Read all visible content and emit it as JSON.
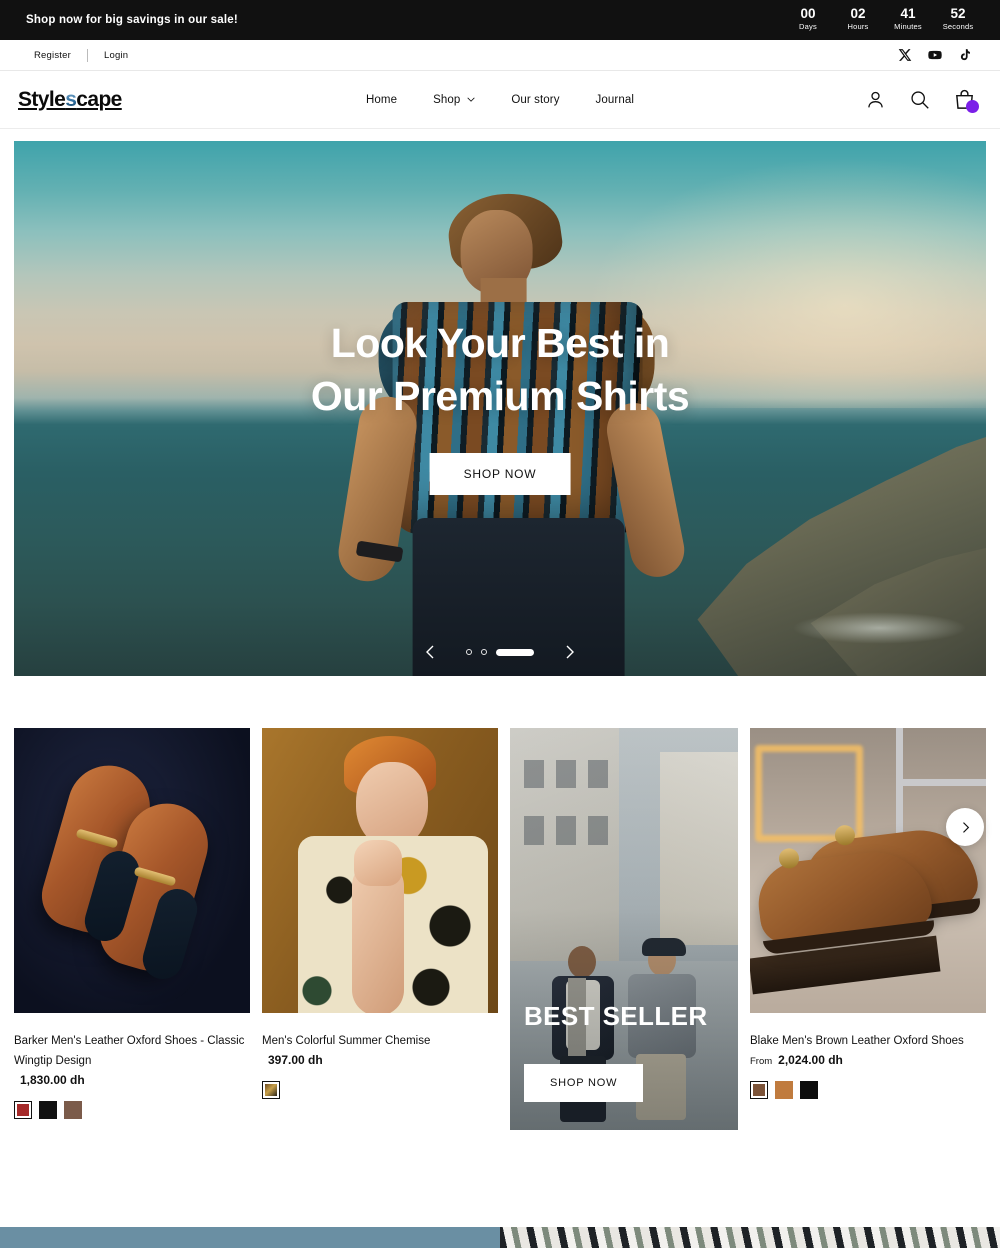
{
  "announcement": {
    "text": "Shop now for big savings in our sale!",
    "countdown": [
      {
        "value": "00",
        "label": "Days"
      },
      {
        "value": "02",
        "label": "Hours"
      },
      {
        "value": "41",
        "label": "Minutes"
      },
      {
        "value": "52",
        "label": "Seconds"
      }
    ]
  },
  "utility": {
    "register": "Register",
    "login": "Login",
    "socials": [
      {
        "name": "x-twitter-icon"
      },
      {
        "name": "youtube-icon"
      },
      {
        "name": "tiktok-icon"
      }
    ]
  },
  "header": {
    "logo_part1": "Style",
    "logo_accent": "s",
    "logo_part2": "cape",
    "nav": [
      {
        "label": "Home",
        "has_chevron": false
      },
      {
        "label": "Shop",
        "has_chevron": true
      },
      {
        "label": "Our story",
        "has_chevron": false
      },
      {
        "label": "Journal",
        "has_chevron": false
      }
    ],
    "icons": {
      "account": "account-icon",
      "search": "search-icon",
      "cart": "cart-icon",
      "cart_badge_color": "#7B1FE8"
    }
  },
  "hero": {
    "heading_line1": "Look Your Best in",
    "heading_line2": "Our Premium Shirts",
    "cta": "SHOP NOW",
    "slides_total": 3,
    "active_slide": 3,
    "prev_label": "Previous slide",
    "next_label": "Next slide"
  },
  "products": [
    {
      "title": "Barker Men's Leather Oxford Shoes - Classic Wingtip Design",
      "price_prefix": "",
      "price": "1,830.00 dh",
      "swatches": [
        {
          "name": "red",
          "color": "#A52A2A",
          "selected": true
        },
        {
          "name": "black",
          "color": "#111111",
          "selected": false
        },
        {
          "name": "brown",
          "color": "#7B5B4A",
          "selected": false
        }
      ]
    },
    {
      "title": "Men's Colorful Summer Chemise",
      "price_prefix": "",
      "price": "397.00 dh",
      "swatches": [
        {
          "name": "multicolor",
          "color": "#8A6A3A",
          "selected": true
        }
      ]
    },
    {
      "title": "Blake Men's Brown Leather Oxford Shoes",
      "price_prefix": "From",
      "price": "2,024.00 dh",
      "swatches": [
        {
          "name": "dark-brown",
          "color": "#7B5237",
          "selected": true
        },
        {
          "name": "tan",
          "color": "#C07B3E",
          "selected": false
        },
        {
          "name": "black",
          "color": "#0D0D0D",
          "selected": false
        }
      ]
    }
  ],
  "promo_card": {
    "title": "BEST SELLER",
    "cta": "SHOP NOW"
  },
  "grid_controls": {
    "next_label": "Next products"
  }
}
